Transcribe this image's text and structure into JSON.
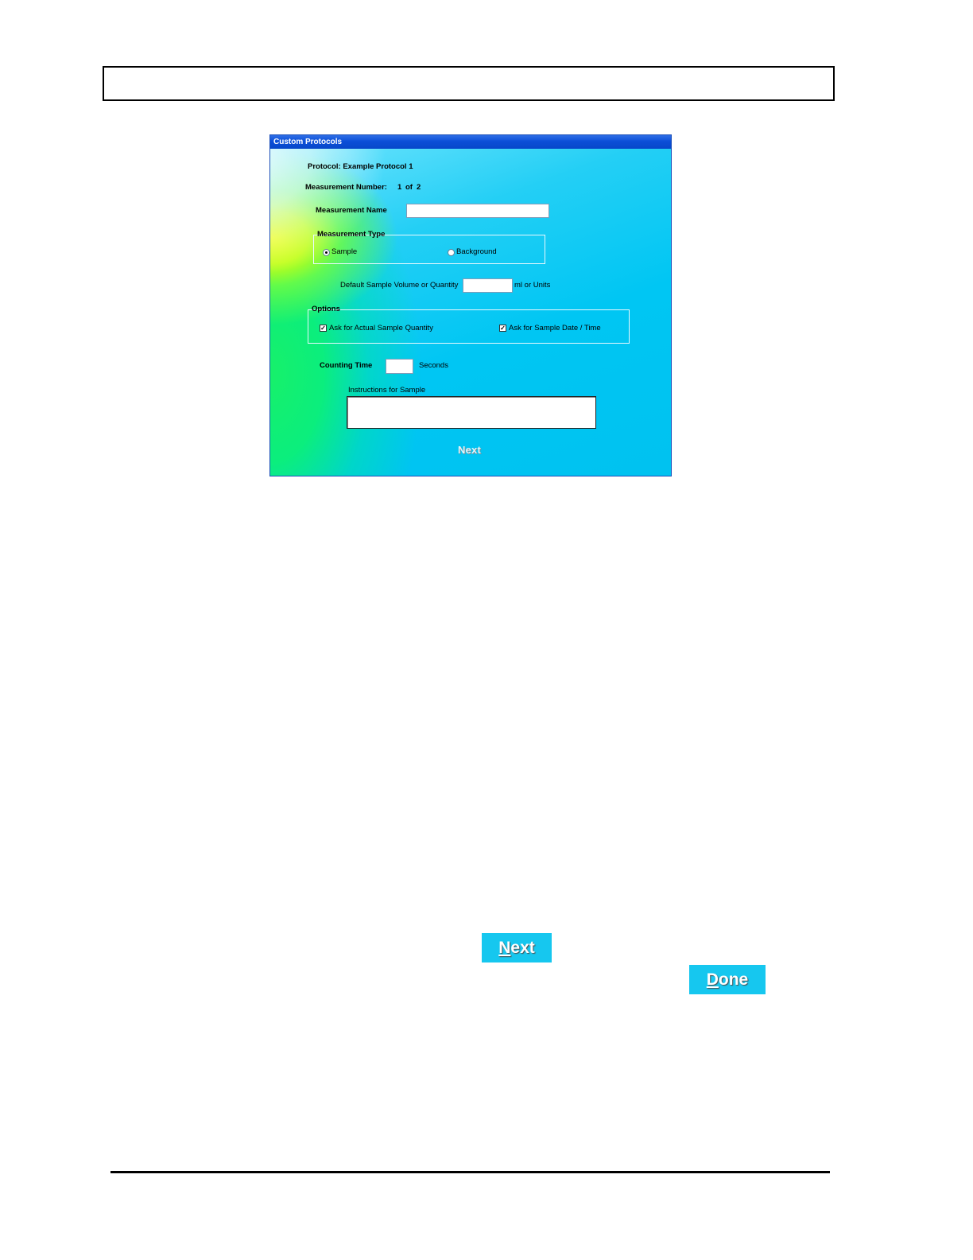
{
  "dialog": {
    "title": "Custom Protocols",
    "protocol_label": "Protocol: Example Protocol 1",
    "measurement_number_label": "Measurement Number:",
    "measurement_number_value": "1",
    "measurement_of": "of",
    "measurement_total": "2",
    "measurement_name_label": "Measurement Name",
    "measurement_name_value": "",
    "measurement_type": {
      "title": "Measurement Type",
      "options": [
        "Sample",
        "Background"
      ],
      "selected": "Sample"
    },
    "default_volume_label": "Default Sample Volume or Quantity",
    "default_volume_value": "",
    "default_volume_units": "ml or Units",
    "options_group": {
      "title": "Options",
      "ask_actual_quantity": "Ask for Actual Sample Quantity",
      "ask_actual_quantity_checked": true,
      "ask_date_time": "Ask for Sample Date / Time",
      "ask_date_time_checked": true
    },
    "counting_time_label": "Counting Time",
    "counting_time_value": "",
    "counting_time_units": "Seconds",
    "instructions_label": "Instructions for Sample",
    "instructions_value": "",
    "next_button": "Next"
  },
  "page_buttons": {
    "next_first": "N",
    "next_rest": "ext",
    "done_first": "D",
    "done_rest": "one"
  }
}
